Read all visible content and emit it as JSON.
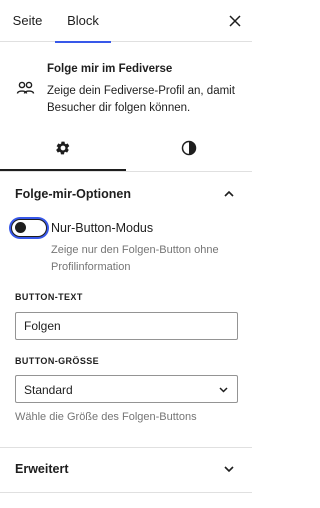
{
  "sidebar_tabs": {
    "items": [
      {
        "label": "Seite"
      },
      {
        "label": "Block"
      }
    ],
    "active": "Block",
    "close_icon": "close-icon"
  },
  "block_card": {
    "icon": "people-icon",
    "title": "Folge mir im Fediverse",
    "description": "Zeige dein Fediverse-Profil an, damit Besucher dir folgen können."
  },
  "inspector_tabs": {
    "items": [
      {
        "icon": "gear-icon"
      },
      {
        "icon": "contrast-icon"
      }
    ],
    "active": 0
  },
  "options_panel": {
    "title": "Folge-mir-Optionen",
    "expanded": true,
    "toggle": {
      "label": "Nur-Button-Modus",
      "checked": false,
      "help": "Zeige nur den Folgen-Button ohne Profilinformation"
    },
    "button_text": {
      "label": "BUTTON-TEXT",
      "value": "Folgen"
    },
    "button_size": {
      "label": "BUTTON-GRÖSSE",
      "value": "Standard",
      "help": "Wähle die Größe des Folgen-Buttons"
    }
  },
  "advanced_panel": {
    "title": "Erweitert",
    "expanded": false
  },
  "colors": {
    "accent": "#3858e9",
    "text": "#1e1e1e",
    "muted": "#757575",
    "border": "#e0e0e0"
  }
}
